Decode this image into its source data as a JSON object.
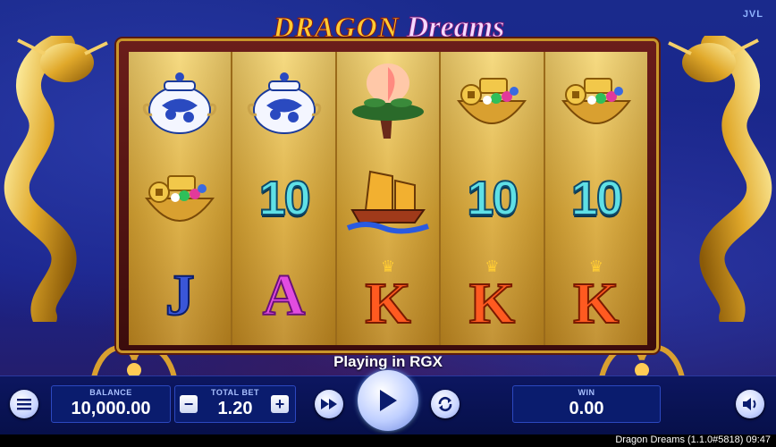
{
  "game": {
    "brand": "JVL",
    "title_word1": "DRAGON",
    "title_word2": "Dreams"
  },
  "reels": [
    [
      "vase-symbol",
      "treasure-bowl-symbol",
      "jack-symbol"
    ],
    [
      "vase-symbol",
      "ten-symbol",
      "ace-symbol"
    ],
    [
      "peach-tree-symbol",
      "junk-ship-symbol",
      "king-symbol"
    ],
    [
      "treasure-bowl-symbol",
      "ten-symbol",
      "king-symbol"
    ],
    [
      "treasure-bowl-symbol",
      "ten-symbol",
      "king-symbol"
    ]
  ],
  "symbols": {
    "ten": "10",
    "jack": "J",
    "ace": "A",
    "king": "K"
  },
  "status_text": "Playing in RGX",
  "controls": {
    "balance_label": "BALANCE",
    "balance_value": "10,000.00",
    "total_bet_label": "TOTAL BET",
    "total_bet_value": "1.20",
    "minus_label": "−",
    "plus_label": "+",
    "win_label": "WIN",
    "win_value": "0.00"
  },
  "footer": "Dragon Dreams (1.1.0#5818) 09:47",
  "colors": {
    "accent": "#ffcc33",
    "panel": "#0a1c6e",
    "teal_ten": "#5fe0e6"
  }
}
